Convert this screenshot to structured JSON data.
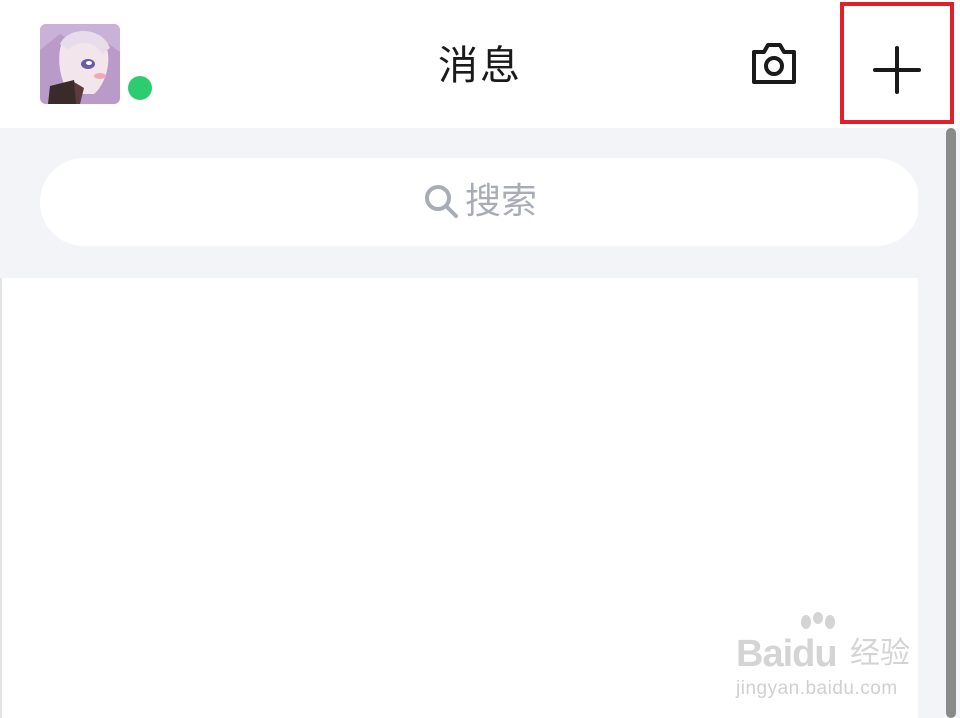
{
  "header": {
    "title": "消息",
    "avatar_icon": "avatar-anime-character",
    "online_status_color": "#2ecc71",
    "camera_icon": "camera-icon",
    "add_icon": "plus-icon",
    "highlight_color": "#e0202a"
  },
  "search": {
    "icon": "search-icon",
    "placeholder": "搜索"
  },
  "watermark": {
    "logo": "Baidu",
    "brand_cn": "经验",
    "url": "jingyan.baidu.com"
  }
}
